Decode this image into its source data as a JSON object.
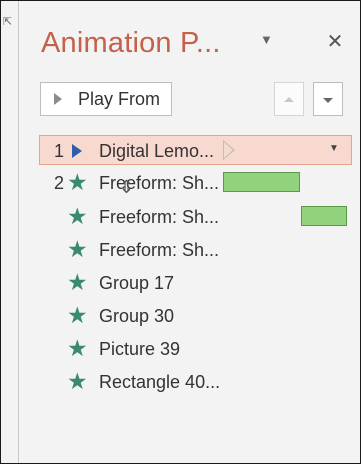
{
  "pane": {
    "title": "Animation P...",
    "title_dropdown_icon": "chevron-down-icon",
    "close_icon": "close-icon"
  },
  "toolbar": {
    "play_label": "Play From",
    "play_icon": "play-icon",
    "move_up_icon": "arrow-up-icon",
    "move_down_icon": "arrow-down-icon"
  },
  "animations": [
    {
      "number": "1",
      "label": "Digital Lemo...",
      "icon": "sound-play-icon",
      "selected": true,
      "timing": "triangle-marker"
    },
    {
      "number": "2",
      "label": "Freeform: Sh...",
      "icon": "star-icon",
      "timing_bar": true
    },
    {
      "number": "",
      "label": "Freeform: Sh...",
      "icon": "star-icon",
      "timing_bar": true
    },
    {
      "number": "",
      "label": "Freeform: Sh...",
      "icon": "star-icon"
    },
    {
      "number": "",
      "label": "Group 17",
      "icon": "star-icon"
    },
    {
      "number": "",
      "label": "Group 30",
      "icon": "star-icon"
    },
    {
      "number": "",
      "label": "Picture 39",
      "icon": "star-icon"
    },
    {
      "number": "",
      "label": "Rectangle 40...",
      "icon": "star-icon"
    }
  ],
  "colors": {
    "title": "#c4614a",
    "star": "#3a8a6e",
    "selected_bg": "#f8d9cf",
    "timing_bar": "#92d27f"
  }
}
